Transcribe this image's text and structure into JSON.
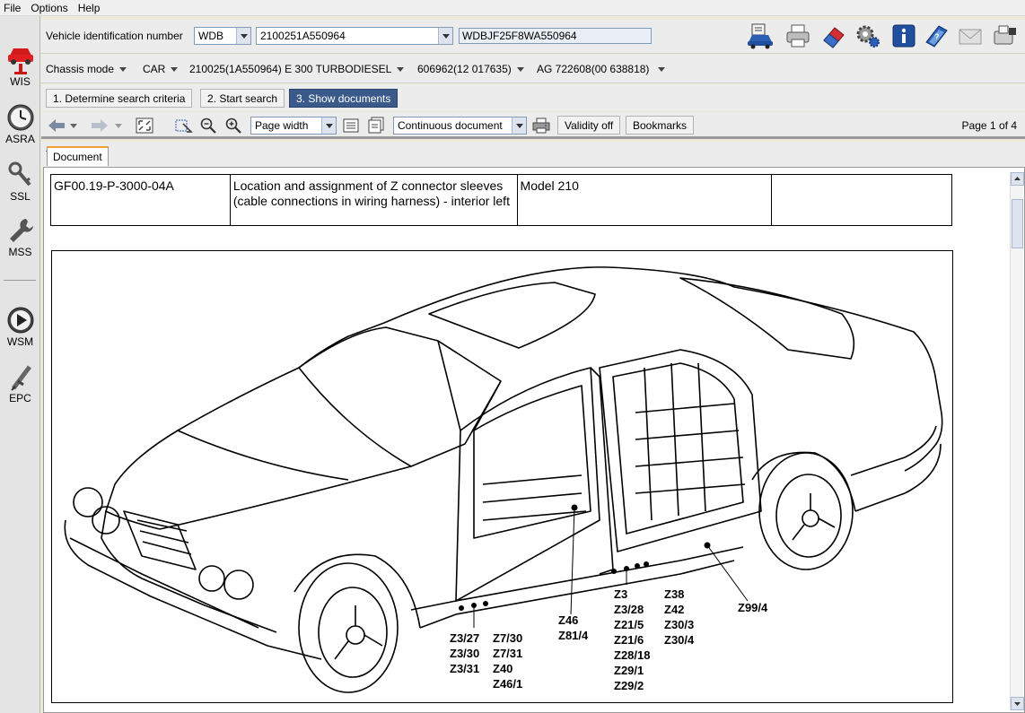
{
  "menu": {
    "file": "File",
    "options": "Options",
    "help": "Help"
  },
  "sidebar": {
    "items": [
      {
        "label": "WIS"
      },
      {
        "label": "ASRA"
      },
      {
        "label": "SSL"
      },
      {
        "label": "MSS"
      },
      {
        "label": "WSM"
      },
      {
        "label": "EPC"
      }
    ]
  },
  "vehicle": {
    "vin_label": "Vehicle identification number",
    "prefix": "WDB",
    "number": "2100251A550964",
    "full_vin": "WDBJF25F8WA550964"
  },
  "chassis": {
    "mode": "Chassis mode",
    "type": "CAR",
    "model": "210025(1A550964) E 300 TURBODIESEL",
    "engine": "606962(12 017635)",
    "transmission": "AG 722608(00 638818)"
  },
  "steps": {
    "step1": "1. Determine search criteria",
    "step2": "2. Start search",
    "step3": "3. Show documents"
  },
  "viewer": {
    "zoom": "Page width",
    "mode": "Continuous document",
    "validity": "Validity off",
    "bookmarks": "Bookmarks",
    "page_label": "Page",
    "page_current": "1",
    "page_of": "of",
    "page_total": "4"
  },
  "tab": {
    "document": "Document"
  },
  "doc": {
    "id": "GF00.19-P-3000-04A",
    "title": "Location and assignment of Z connector sleeves (cable connections in wiring harness) - interior left",
    "model": "Model 210",
    "extra": ""
  },
  "labels": {
    "group_a": [
      "Z3/27",
      "Z3/30",
      "Z3/31"
    ],
    "group_b": [
      "Z7/30",
      "Z7/31",
      "Z40",
      "Z46/1"
    ],
    "group_c": [
      "Z46",
      "Z81/4"
    ],
    "group_d": [
      "Z3",
      "Z3/28",
      "Z21/5",
      "Z21/6",
      "Z28/18",
      "Z29/1",
      "Z29/2"
    ],
    "group_e": [
      "Z38",
      "Z42",
      "Z30/3",
      "Z30/4"
    ],
    "group_f": [
      "Z99/4"
    ]
  }
}
